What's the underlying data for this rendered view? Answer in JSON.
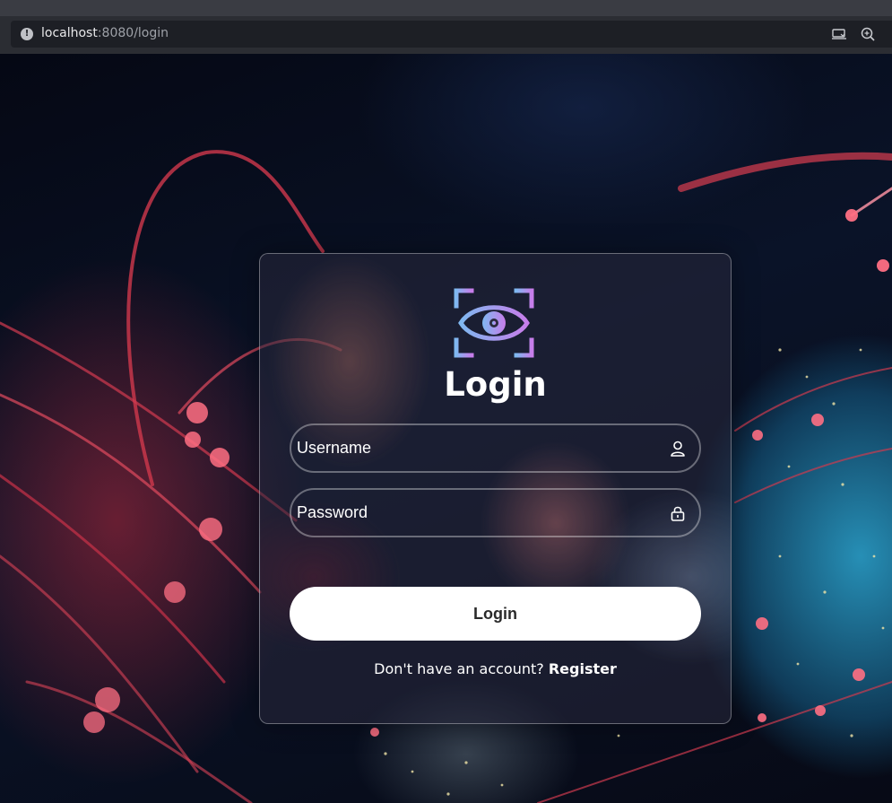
{
  "browser": {
    "url_host": "localhost",
    "url_rest": ":8080/login",
    "icons": [
      "info-icon",
      "cast-icon",
      "zoom-icon"
    ]
  },
  "login": {
    "title": "Login",
    "username_placeholder": "Username",
    "password_placeholder": "Password",
    "username_value": "",
    "password_value": "",
    "submit_label": "Login",
    "register_prompt": "Don't have an account?",
    "register_link": "Register",
    "icons": [
      "eye-scan-logo-icon",
      "user-icon",
      "lock-icon"
    ]
  },
  "colors": {
    "logo_gradient_start": "#7fb8f0",
    "logo_gradient_end": "#c77dea",
    "button_bg": "#ffffff",
    "text": "#ffffff"
  }
}
